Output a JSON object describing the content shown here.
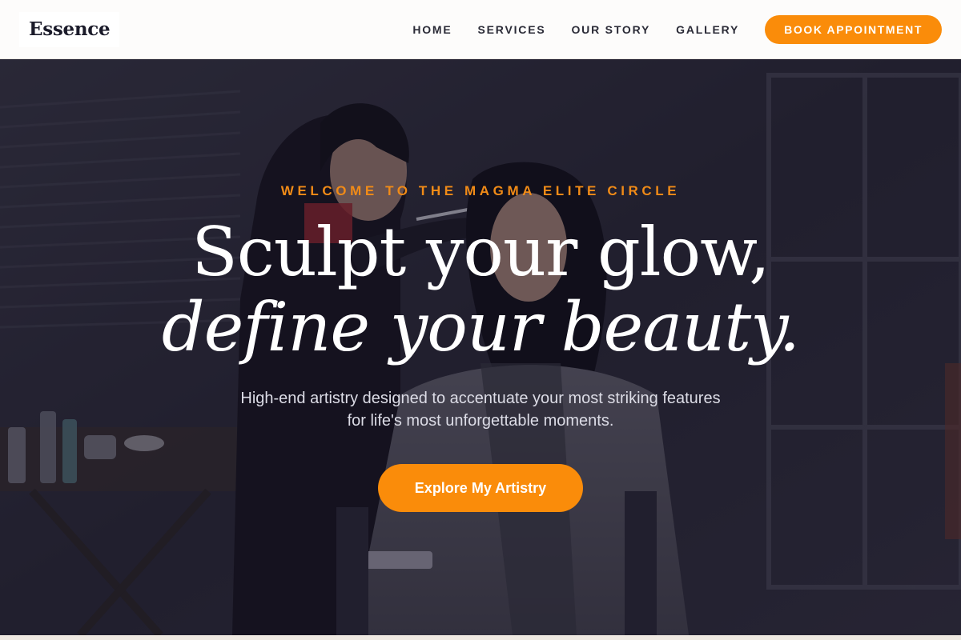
{
  "brand": {
    "name": "Essence"
  },
  "nav": {
    "links": [
      "HOME",
      "SERVICES",
      "OUR STORY",
      "GALLERY"
    ],
    "cta": "BOOK APPOINTMENT"
  },
  "hero": {
    "eyebrow": "WELCOME TO THE MAGMA ELITE CIRCLE",
    "headline_line1": "Sculpt your glow,",
    "headline_line2": "define your beauty.",
    "subtitle": "High-end artistry designed to accentuate your most striking features for life's most unforgettable moments.",
    "cta": "Explore My Artistry"
  },
  "colors": {
    "accent": "#fa8c0a",
    "eyebrow": "#f18b17",
    "nav_bg": "#fdfcfb",
    "text_dark": "#1b1b2a"
  }
}
